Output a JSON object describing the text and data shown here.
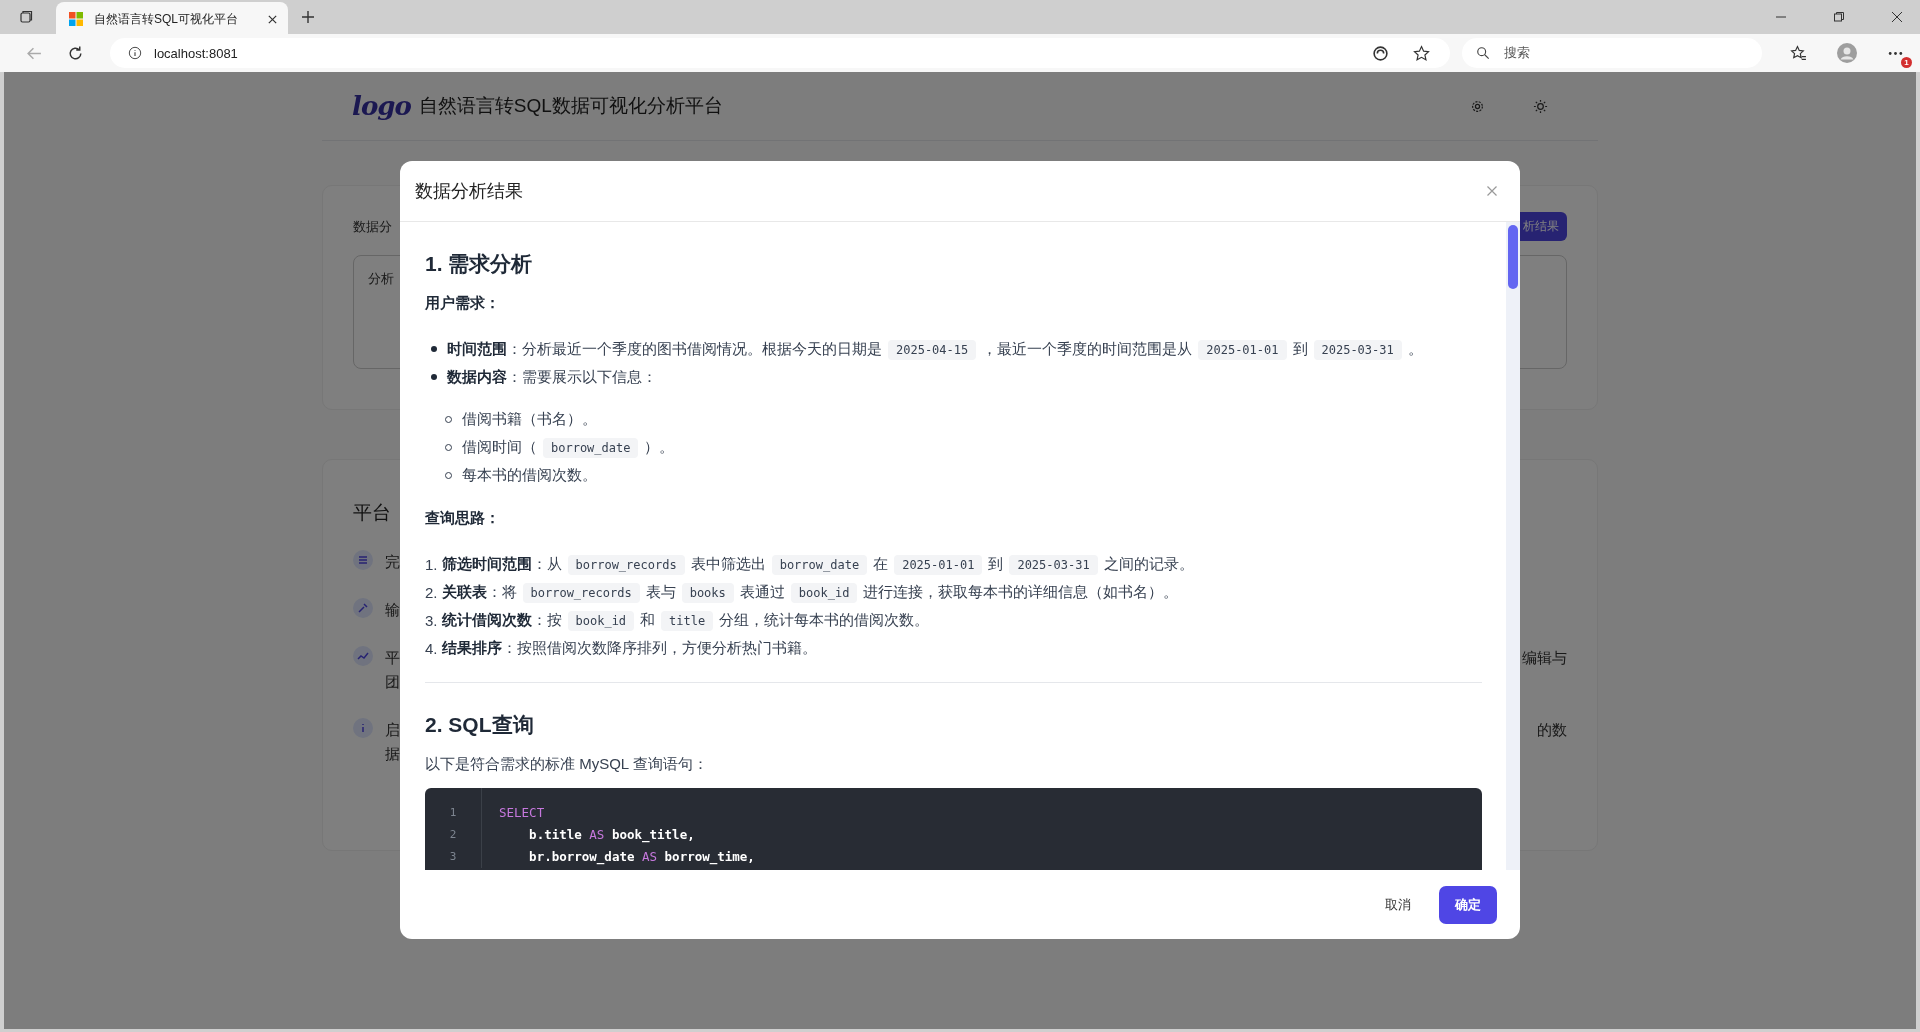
{
  "browser": {
    "tab_title": "自然语言转SQL可视化平台",
    "address": "localhost:8081",
    "search_placeholder": "搜索",
    "notification_count": "1"
  },
  "page": {
    "logo": "logo",
    "title": "自然语言转SQL数据可视化分析平台",
    "query_card": {
      "label": "数据分",
      "button": "析结果",
      "input_label": "分析"
    },
    "features_card": {
      "heading": "平台",
      "items": [
        {
          "left": [
            "完"
          ]
        },
        {
          "left": [
            "输"
          ]
        },
        {
          "left": [
            "平",
            "团"
          ],
          "right": [
            "编辑与"
          ]
        },
        {
          "left": [
            "启",
            "据"
          ],
          "right": [
            "的数"
          ]
        }
      ]
    }
  },
  "modal": {
    "title": "数据分析结果",
    "blocks": [
      {
        "kind": "heading",
        "text": "1. 需求分析"
      },
      {
        "kind": "subheading",
        "text": "用户需求："
      },
      {
        "kind": "bullets",
        "items": [
          {
            "segments": [
              {
                "kind": "bold",
                "text": "时间范围"
              },
              {
                "kind": "text",
                "text": "：分析最近一个季度的图书借阅情况。根据今天的日期是"
              },
              {
                "kind": "code",
                "text": "2025-04-15"
              },
              {
                "kind": "text",
                "text": "，最近一个季度的时间范围是从"
              },
              {
                "kind": "code",
                "text": "2025-01-01"
              },
              {
                "kind": "text",
                "text": "到"
              },
              {
                "kind": "code",
                "text": "2025-03-31"
              },
              {
                "kind": "text",
                "text": "。"
              }
            ]
          },
          {
            "segments": [
              {
                "kind": "bold",
                "text": "数据内容"
              },
              {
                "kind": "text",
                "text": "：需要展示以下信息："
              }
            ],
            "children": [
              {
                "segments": [
                  {
                    "kind": "text",
                    "text": "借阅书籍（书名）。"
                  }
                ]
              },
              {
                "segments": [
                  {
                    "kind": "text",
                    "text": "借阅时间（"
                  },
                  {
                    "kind": "code",
                    "text": "borrow_date"
                  },
                  {
                    "kind": "text",
                    "text": "）。"
                  }
                ]
              },
              {
                "segments": [
                  {
                    "kind": "text",
                    "text": "每本书的借阅次数。"
                  }
                ]
              }
            ]
          }
        ]
      },
      {
        "kind": "subheading",
        "text": "查询思路："
      },
      {
        "kind": "ordered",
        "items": [
          {
            "marker": "1.",
            "segments": [
              {
                "kind": "bold",
                "text": "筛选时间范围"
              },
              {
                "kind": "text",
                "text": "：从"
              },
              {
                "kind": "code",
                "text": "borrow_records"
              },
              {
                "kind": "text",
                "text": "表中筛选出"
              },
              {
                "kind": "code",
                "text": "borrow_date"
              },
              {
                "kind": "text",
                "text": "在"
              },
              {
                "kind": "code",
                "text": "2025-01-01"
              },
              {
                "kind": "text",
                "text": "到"
              },
              {
                "kind": "code",
                "text": "2025-03-31"
              },
              {
                "kind": "text",
                "text": "之间的记录。"
              }
            ]
          },
          {
            "marker": "2.",
            "segments": [
              {
                "kind": "bold",
                "text": "关联表"
              },
              {
                "kind": "text",
                "text": "：将"
              },
              {
                "kind": "code",
                "text": "borrow_records"
              },
              {
                "kind": "text",
                "text": "表与"
              },
              {
                "kind": "code",
                "text": "books"
              },
              {
                "kind": "text",
                "text": "表通过"
              },
              {
                "kind": "code",
                "text": "book_id"
              },
              {
                "kind": "text",
                "text": "进行连接，获取每本书的详细信息（如书名）。"
              }
            ]
          },
          {
            "marker": "3.",
            "segments": [
              {
                "kind": "bold",
                "text": "统计借阅次数"
              },
              {
                "kind": "text",
                "text": "：按"
              },
              {
                "kind": "code",
                "text": "book_id"
              },
              {
                "kind": "text",
                "text": "和"
              },
              {
                "kind": "code",
                "text": "title"
              },
              {
                "kind": "text",
                "text": "分组，统计每本书的借阅次数。"
              }
            ]
          },
          {
            "marker": "4.",
            "segments": [
              {
                "kind": "bold",
                "text": "结果排序"
              },
              {
                "kind": "text",
                "text": "：按照借阅次数降序排列，方便分析热门书籍。"
              }
            ]
          }
        ]
      },
      {
        "kind": "rule"
      },
      {
        "kind": "heading",
        "text": "2. SQL查询"
      },
      {
        "kind": "paragraph",
        "text": "以下是符合需求的标准 MySQL 查询语句："
      },
      {
        "kind": "code",
        "lines": [
          {
            "number": "1",
            "tokens": [
              {
                "kind": "keyword",
                "text": "SELECT"
              }
            ]
          },
          {
            "number": "2",
            "tokens": [
              {
                "kind": "plain",
                "text": "    b.title "
              },
              {
                "kind": "keyword",
                "text": "AS"
              },
              {
                "kind": "plain",
                "text": " book_title,"
              }
            ]
          },
          {
            "number": "3",
            "tokens": [
              {
                "kind": "plain",
                "text": "    br.borrow_date "
              },
              {
                "kind": "keyword",
                "text": "AS"
              },
              {
                "kind": "plain",
                "text": " borrow_time,"
              }
            ]
          }
        ]
      }
    ],
    "cancel_button": "取消",
    "ok_button": "确定"
  }
}
